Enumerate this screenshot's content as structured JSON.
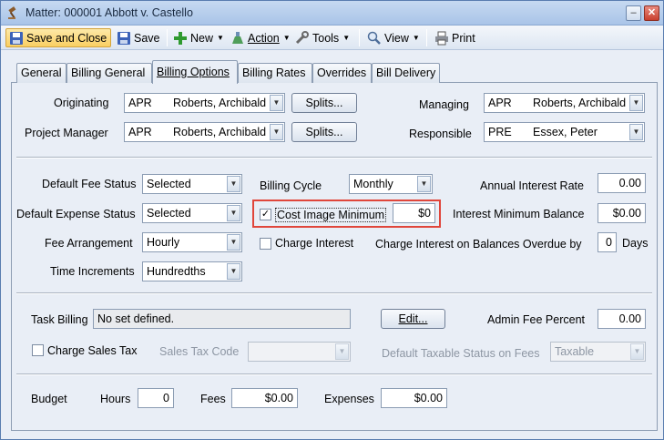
{
  "window": {
    "title": "Matter: 000001 Abbott v. Castello"
  },
  "toolbar": {
    "save_close": "Save and Close",
    "save": "Save",
    "new": "New",
    "action": "Action",
    "tools": "Tools",
    "view": "View",
    "print": "Print"
  },
  "tabs": [
    "General",
    "Billing General",
    "Billing Options",
    "Billing Rates",
    "Overrides",
    "Bill Delivery"
  ],
  "active_tab": "Billing Options",
  "people": {
    "originating_label": "Originating",
    "originating_code": "APR",
    "originating_name": "Roberts, Archibald",
    "project_manager_label": "Project Manager",
    "project_manager_code": "APR",
    "project_manager_name": "Roberts, Archibald",
    "splits_label": "Splits...",
    "managing_label": "Managing",
    "managing_code": "APR",
    "managing_name": "Roberts, Archibald",
    "responsible_label": "Responsible",
    "responsible_code": "PRE",
    "responsible_name": "Essex, Peter"
  },
  "options": {
    "default_fee_status_label": "Default Fee Status",
    "default_fee_status": "Selected",
    "default_expense_status_label": "Default Expense Status",
    "default_expense_status": "Selected",
    "fee_arrangement_label": "Fee Arrangement",
    "fee_arrangement": "Hourly",
    "time_increments_label": "Time Increments",
    "time_increments": "Hundredths",
    "billing_cycle_label": "Billing Cycle",
    "billing_cycle": "Monthly",
    "cost_image_minimum_label": "Cost Image Minimum",
    "cost_image_minimum_checked": true,
    "cost_image_minimum": "$0",
    "charge_interest_label": "Charge Interest",
    "charge_interest_checked": false,
    "annual_interest_rate_label": "Annual Interest Rate",
    "annual_interest_rate": "0.00",
    "interest_minimum_balance_label": "Interest Minimum Balance",
    "interest_minimum_balance": "$0.00",
    "charge_interest_overdue_label": "Charge Interest on Balances Overdue by",
    "overdue_days": "0",
    "days_label": "Days"
  },
  "billing": {
    "task_billing_label": "Task Billing",
    "task_billing_value": "No set defined.",
    "edit_label": "Edit...",
    "admin_fee_percent_label": "Admin Fee Percent",
    "admin_fee_percent": "0.00",
    "charge_sales_tax_label": "Charge Sales Tax",
    "sales_tax_code_label": "Sales Tax Code",
    "sales_tax_code": "",
    "default_taxable_label": "Default Taxable Status on Fees",
    "default_taxable": "Taxable"
  },
  "budget": {
    "budget_label": "Budget",
    "hours_label": "Hours",
    "hours": "0",
    "fees_label": "Fees",
    "fees": "$0.00",
    "expenses_label": "Expenses",
    "expenses": "$0.00"
  },
  "colors": {
    "highlight_box": "#e0463b",
    "active_tool": "#f9cf62"
  }
}
